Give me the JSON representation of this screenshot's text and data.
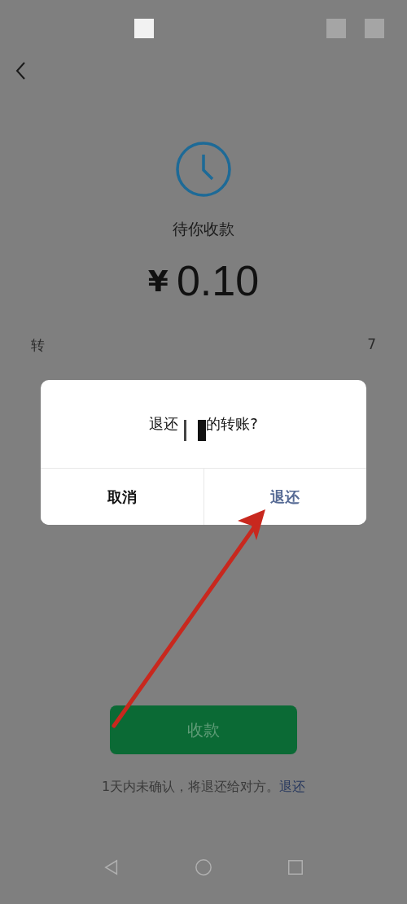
{
  "payment": {
    "status": "待你收款",
    "currency": "¥",
    "amount": "0.10"
  },
  "detail_row": {
    "label": "转",
    "value": "7"
  },
  "receive_button": {
    "label": "收款",
    "disabled": true
  },
  "note": {
    "text": "1天内未确认，将退还给对方。",
    "link": "退还"
  },
  "dialog": {
    "title_before": "退还",
    "title_after": "的转账?",
    "redacted": true,
    "buttons": [
      {
        "label": "取消",
        "kind": "cancel"
      },
      {
        "label": "退还",
        "kind": "confirm"
      }
    ]
  }
}
